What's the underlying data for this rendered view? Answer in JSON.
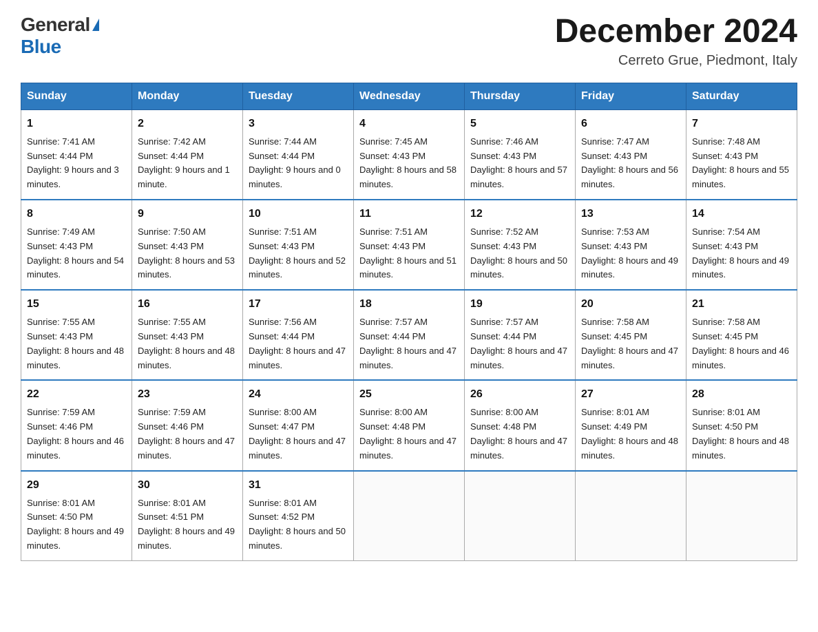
{
  "header": {
    "logo": {
      "general": "General",
      "blue": "Blue",
      "tagline": ""
    },
    "title": "December 2024",
    "location": "Cerreto Grue, Piedmont, Italy"
  },
  "days_of_week": [
    "Sunday",
    "Monday",
    "Tuesday",
    "Wednesday",
    "Thursday",
    "Friday",
    "Saturday"
  ],
  "weeks": [
    [
      {
        "day": "1",
        "sunrise": "7:41 AM",
        "sunset": "4:44 PM",
        "daylight": "9 hours and 3 minutes."
      },
      {
        "day": "2",
        "sunrise": "7:42 AM",
        "sunset": "4:44 PM",
        "daylight": "9 hours and 1 minute."
      },
      {
        "day": "3",
        "sunrise": "7:44 AM",
        "sunset": "4:44 PM",
        "daylight": "9 hours and 0 minutes."
      },
      {
        "day": "4",
        "sunrise": "7:45 AM",
        "sunset": "4:43 PM",
        "daylight": "8 hours and 58 minutes."
      },
      {
        "day": "5",
        "sunrise": "7:46 AM",
        "sunset": "4:43 PM",
        "daylight": "8 hours and 57 minutes."
      },
      {
        "day": "6",
        "sunrise": "7:47 AM",
        "sunset": "4:43 PM",
        "daylight": "8 hours and 56 minutes."
      },
      {
        "day": "7",
        "sunrise": "7:48 AM",
        "sunset": "4:43 PM",
        "daylight": "8 hours and 55 minutes."
      }
    ],
    [
      {
        "day": "8",
        "sunrise": "7:49 AM",
        "sunset": "4:43 PM",
        "daylight": "8 hours and 54 minutes."
      },
      {
        "day": "9",
        "sunrise": "7:50 AM",
        "sunset": "4:43 PM",
        "daylight": "8 hours and 53 minutes."
      },
      {
        "day": "10",
        "sunrise": "7:51 AM",
        "sunset": "4:43 PM",
        "daylight": "8 hours and 52 minutes."
      },
      {
        "day": "11",
        "sunrise": "7:51 AM",
        "sunset": "4:43 PM",
        "daylight": "8 hours and 51 minutes."
      },
      {
        "day": "12",
        "sunrise": "7:52 AM",
        "sunset": "4:43 PM",
        "daylight": "8 hours and 50 minutes."
      },
      {
        "day": "13",
        "sunrise": "7:53 AM",
        "sunset": "4:43 PM",
        "daylight": "8 hours and 49 minutes."
      },
      {
        "day": "14",
        "sunrise": "7:54 AM",
        "sunset": "4:43 PM",
        "daylight": "8 hours and 49 minutes."
      }
    ],
    [
      {
        "day": "15",
        "sunrise": "7:55 AM",
        "sunset": "4:43 PM",
        "daylight": "8 hours and 48 minutes."
      },
      {
        "day": "16",
        "sunrise": "7:55 AM",
        "sunset": "4:43 PM",
        "daylight": "8 hours and 48 minutes."
      },
      {
        "day": "17",
        "sunrise": "7:56 AM",
        "sunset": "4:44 PM",
        "daylight": "8 hours and 47 minutes."
      },
      {
        "day": "18",
        "sunrise": "7:57 AM",
        "sunset": "4:44 PM",
        "daylight": "8 hours and 47 minutes."
      },
      {
        "day": "19",
        "sunrise": "7:57 AM",
        "sunset": "4:44 PM",
        "daylight": "8 hours and 47 minutes."
      },
      {
        "day": "20",
        "sunrise": "7:58 AM",
        "sunset": "4:45 PM",
        "daylight": "8 hours and 47 minutes."
      },
      {
        "day": "21",
        "sunrise": "7:58 AM",
        "sunset": "4:45 PM",
        "daylight": "8 hours and 46 minutes."
      }
    ],
    [
      {
        "day": "22",
        "sunrise": "7:59 AM",
        "sunset": "4:46 PM",
        "daylight": "8 hours and 46 minutes."
      },
      {
        "day": "23",
        "sunrise": "7:59 AM",
        "sunset": "4:46 PM",
        "daylight": "8 hours and 47 minutes."
      },
      {
        "day": "24",
        "sunrise": "8:00 AM",
        "sunset": "4:47 PM",
        "daylight": "8 hours and 47 minutes."
      },
      {
        "day": "25",
        "sunrise": "8:00 AM",
        "sunset": "4:48 PM",
        "daylight": "8 hours and 47 minutes."
      },
      {
        "day": "26",
        "sunrise": "8:00 AM",
        "sunset": "4:48 PM",
        "daylight": "8 hours and 47 minutes."
      },
      {
        "day": "27",
        "sunrise": "8:01 AM",
        "sunset": "4:49 PM",
        "daylight": "8 hours and 48 minutes."
      },
      {
        "day": "28",
        "sunrise": "8:01 AM",
        "sunset": "4:50 PM",
        "daylight": "8 hours and 48 minutes."
      }
    ],
    [
      {
        "day": "29",
        "sunrise": "8:01 AM",
        "sunset": "4:50 PM",
        "daylight": "8 hours and 49 minutes."
      },
      {
        "day": "30",
        "sunrise": "8:01 AM",
        "sunset": "4:51 PM",
        "daylight": "8 hours and 49 minutes."
      },
      {
        "day": "31",
        "sunrise": "8:01 AM",
        "sunset": "4:52 PM",
        "daylight": "8 hours and 50 minutes."
      },
      null,
      null,
      null,
      null
    ]
  ]
}
